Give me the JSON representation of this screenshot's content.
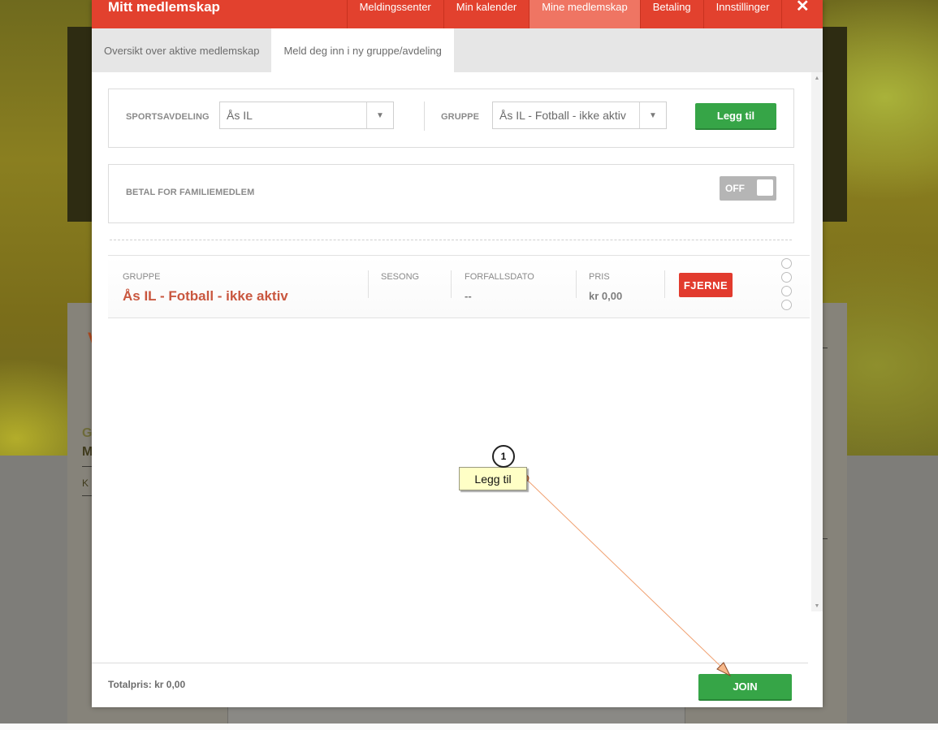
{
  "modal": {
    "title": "Mitt medlemskap",
    "nav": [
      "Meldingssenter",
      "Min kalender",
      "Mine medlemskap",
      "Betaling",
      "Innstillinger"
    ],
    "active_nav": "Mine medlemskap",
    "close_glyph": "✕"
  },
  "subtabs": [
    "Oversikt over aktive medlemskap",
    "Meld deg inn i ny gruppe/avdeling"
  ],
  "active_subtab": "Meld deg inn i ny gruppe/avdeling",
  "form": {
    "sport_label": "SPORTSAVDELING",
    "sport_value": "Ås IL",
    "group_label": "GRUPPE",
    "group_value": "Ås IL - Fotball - ikke aktiv",
    "add_button": "Legg til"
  },
  "family": {
    "label": "BETAL FOR FAMILIEMEDLEM",
    "toggle_text": "OFF",
    "toggle_on": false
  },
  "membership_row": {
    "group_label": "GRUPPE",
    "group_value": "Ås IL - Fotball - ikke aktiv",
    "season_label": "SESONG",
    "due_label": "FORFALLSDATO",
    "due_value": "--",
    "price_label": "PRIS",
    "price_value": "kr 0,00",
    "remove_button": "FJERNE"
  },
  "footer": {
    "total": "Totalpris: kr 0,00",
    "join_button": "JOIN"
  },
  "annotation": {
    "step_number": "1",
    "callout_text": "Legg til"
  },
  "colors": {
    "header_red": "#e2412e",
    "active_tab": "#ef7563",
    "green": "#36a547",
    "remove_red": "#e23b2e",
    "group_name": "#c9573f"
  },
  "icons": {
    "dropdown": "chevron-down-icon",
    "close": "close-icon",
    "scroll_up": "scroll-up-icon",
    "scroll_down": "scroll-down-icon"
  }
}
